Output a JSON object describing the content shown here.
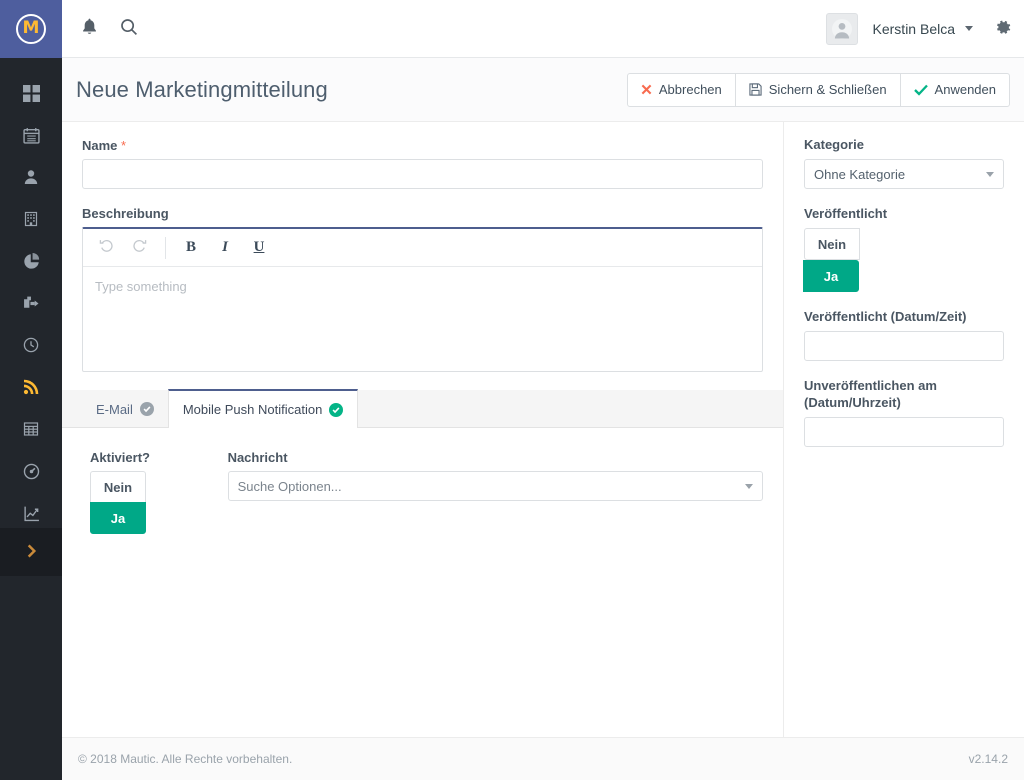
{
  "brand": {
    "logo_letter": "M",
    "accent_orange": "#fdb933",
    "sidebar_bg": "#22262c",
    "logo_bg": "#4e5e9e",
    "teal": "#00a887",
    "red": "#f86b4f",
    "tab_active_border": "#4e5e8e"
  },
  "rail": {
    "items": [
      {
        "name": "dashboard-icon",
        "label": "Dashboard"
      },
      {
        "name": "calendar-icon",
        "label": "Kalender"
      },
      {
        "name": "contacts-icon",
        "label": "Kontakte"
      },
      {
        "name": "companies-icon",
        "label": "Firmen"
      },
      {
        "name": "segments-icon",
        "label": "Segmente"
      },
      {
        "name": "campaigns-icon",
        "label": "Kampagnen"
      },
      {
        "name": "points-icon",
        "label": "Punkte"
      },
      {
        "name": "channels-icon",
        "label": "Kanäle"
      },
      {
        "name": "components-icon",
        "label": "Komponenten"
      },
      {
        "name": "stages-icon",
        "label": "Stufen"
      },
      {
        "name": "reports-icon",
        "label": "Berichte"
      }
    ],
    "expand_label": "Menü ausklappen"
  },
  "topbar": {
    "notifications_icon": "bell-icon",
    "search_icon": "search-icon",
    "user_name": "Kerstin Belca",
    "settings_icon": "gear-icon"
  },
  "header": {
    "title": "Neue Marketingmitteilung",
    "buttons": [
      {
        "label": "Abbrechen",
        "icon": "close-x-icon"
      },
      {
        "label": "Sichern & Schließen",
        "icon": "save-disk-icon"
      },
      {
        "label": "Anwenden",
        "icon": "check-icon"
      }
    ]
  },
  "form": {
    "name_label": "Name",
    "name_required_mark": "*",
    "name_value": "",
    "name_placeholder": "",
    "description_label": "Beschreibung",
    "editor": {
      "undo_icon": "undo-icon",
      "redo_icon": "redo-icon",
      "bold_label": "B",
      "italic_label": "I",
      "underline_label": "U",
      "placeholder": "Type something"
    }
  },
  "tabs": [
    {
      "label": "E-Mail",
      "badge": "check",
      "badge_color": "gray",
      "active": false
    },
    {
      "label": "Mobile Push Notification",
      "badge": "check",
      "badge_color": "green",
      "active": true
    }
  ],
  "tab_panel": {
    "enabled_label": "Aktiviert?",
    "enabled_no": "Nein",
    "enabled_yes": "Ja",
    "enabled_value": "Ja",
    "message_label": "Nachricht",
    "message_placeholder": "Suche Optionen..."
  },
  "sidebar_panel": {
    "category_label": "Kategorie",
    "category_value": "Ohne Kategorie",
    "published_label": "Veröffentlicht",
    "published_no": "Nein",
    "published_yes": "Ja",
    "published_value": "Ja",
    "publish_at_label": "Veröffentlicht (Datum/Zeit)",
    "publish_at_value": "",
    "unpublish_at_label": "Unveröffentlichen am (Datum/Uhrzeit)",
    "unpublish_at_value": ""
  },
  "footer": {
    "copyright": "© 2018 Mautic. Alle Rechte vorbehalten.",
    "version": "v2.14.2"
  }
}
